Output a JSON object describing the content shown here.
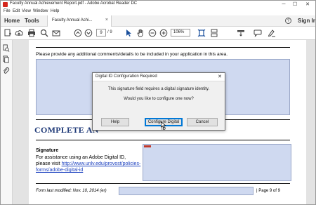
{
  "window": {
    "title": "Faculty Annual Achievement Report.pdf - Adobe Acrobat Reader DC",
    "minimize_glyph": "─",
    "maximize_glyph": "☐",
    "close_glyph": "✕"
  },
  "menu": [
    "File",
    "Edit",
    "View",
    "Window",
    "Help"
  ],
  "tabs": {
    "home": "Home",
    "tools": "Tools",
    "document": "Faculty Annual Achi...",
    "close_glyph": "×",
    "help_glyph": "?",
    "sign_in": "Sign In"
  },
  "toolbar": {
    "page_current": "9",
    "page_total": "/ 9",
    "zoom": "106%",
    "icons": [
      "create-pdf-icon",
      "cloud-upload-icon",
      "print-icon",
      "search-icon",
      "mail-icon",
      "page-up-icon",
      "page-down-icon",
      "select-cursor-icon",
      "hand-icon",
      "zoom-out-icon",
      "zoom-in-icon",
      "fit-page-icon",
      "scroll-mode-icon",
      "highlight-icon",
      "comment-icon",
      "sign-icon"
    ]
  },
  "document": {
    "instructions": "Please provide any additional comments/details to be included in your application in this area.",
    "heading": "COMPLETE AN",
    "signature_heading": "Signature",
    "signature_text": "For assistance using an Adobe Digital ID, please visit ",
    "signature_link": "http://www.unlv.edu/provost/policies-forms/adobe-digital-id",
    "form_modified": "Form last modified: Nov. 10, 2014 (er)",
    "page_of": "| Page 9 of 9"
  },
  "dialog": {
    "title": "Digital ID Configuration Required",
    "close_glyph": "✕",
    "line1": "This signature field requires a digital signature identity.",
    "line2": "Would you like to configure one now?",
    "help_button": "Help",
    "configure_button": "Configure Digital ID",
    "cancel_button": "Cancel"
  },
  "colors": {
    "field_fill": "#cfd9f0",
    "heading": "#1f3a78",
    "link": "#1a3fbf",
    "acrobat_red": "#d4261c",
    "focus_blue": "#0078d7"
  }
}
